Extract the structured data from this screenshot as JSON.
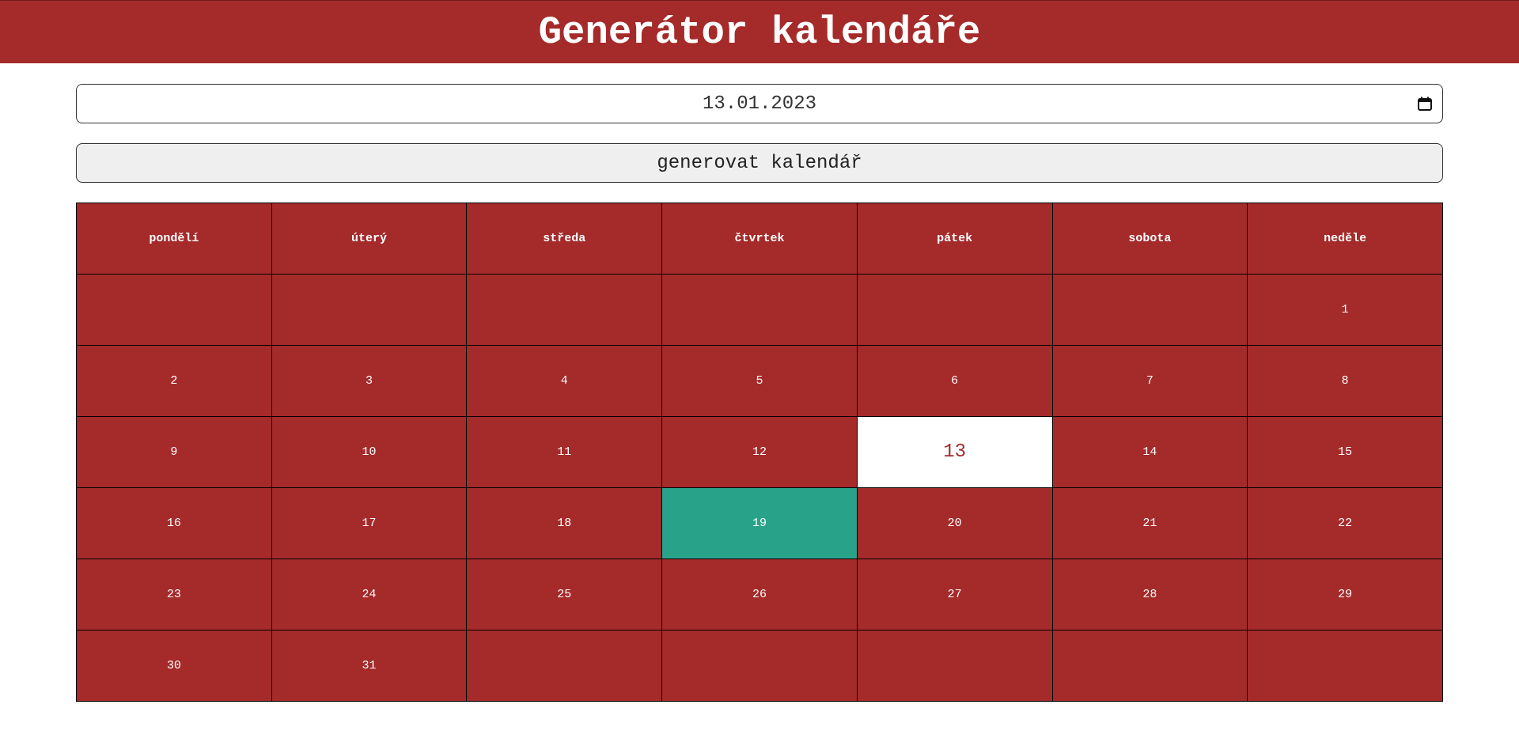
{
  "header": {
    "title": "Generátor kalendáře"
  },
  "date_input": {
    "value": "13.01.2023",
    "icon": "calendar-icon"
  },
  "generate_button": {
    "label": "generovat kalendář"
  },
  "calendar": {
    "weekdays": [
      "pondělí",
      "úterý",
      "středa",
      "čtvrtek",
      "pátek",
      "sobota",
      "neděle"
    ],
    "weeks": [
      [
        "",
        "",
        "",
        "",
        "",
        "",
        "1"
      ],
      [
        "2",
        "3",
        "4",
        "5",
        "6",
        "7",
        "8"
      ],
      [
        "9",
        "10",
        "11",
        "12",
        "13",
        "14",
        "15"
      ],
      [
        "16",
        "17",
        "18",
        "19",
        "20",
        "21",
        "22"
      ],
      [
        "23",
        "24",
        "25",
        "26",
        "27",
        "28",
        "29"
      ],
      [
        "30",
        "31",
        "",
        "",
        "",
        "",
        ""
      ]
    ],
    "selected_day": "13",
    "today_day": "19"
  },
  "colors": {
    "primary": "#a52a2a",
    "today": "#28a38a",
    "selected_bg": "#ffffff"
  }
}
